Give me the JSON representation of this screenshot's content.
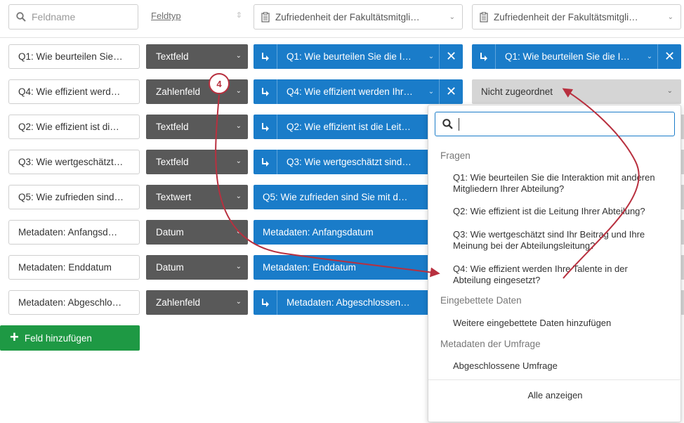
{
  "header": {
    "search_placeholder": "Feldname",
    "fieldtype_label": "Feldtyp",
    "survey_select_1": "Zufriedenheit der Fakultätsmitgli…",
    "survey_select_2": "Zufriedenheit der Fakultätsmitgli…"
  },
  "rows": [
    {
      "name": "Q1: Wie beurteilen Sie…",
      "type": "Textfeld",
      "map1": "Q1: Wie beurteilen Sie die I…",
      "map2": "Q1: Wie beurteilen Sie die I…"
    },
    {
      "name": "Q4: Wie effizient werd…",
      "type": "Zahlenfeld",
      "map1": "Q4: Wie effizient werden Ihr…",
      "map2": "Nicht zugeordnet"
    },
    {
      "name": "Q2: Wie effizient ist di…",
      "type": "Textfeld",
      "map1": "Q2: Wie effizient ist die Leit…"
    },
    {
      "name": "Q3: Wie wertgeschätzt…",
      "type": "Textfeld",
      "map1": "Q3: Wie wertgeschätzt sind…"
    },
    {
      "name": "Q5: Wie zufrieden sind…",
      "type": "Textwert",
      "map1": "Q5: Wie zufrieden sind Sie mit d…"
    },
    {
      "name": "Metadaten: Anfangsd…",
      "type": "Datum",
      "map1": "Metadaten: Anfangsdatum"
    },
    {
      "name": "Metadaten: Enddatum",
      "type": "Datum",
      "map1": "Metadaten: Enddatum"
    },
    {
      "name": "Metadaten: Abgeschlo…",
      "type": "Zahlenfeld",
      "map1": "Metadaten: Abgeschlossen…"
    }
  ],
  "add_field_label": "Feld hinzufügen",
  "badge_number": "4",
  "dropdown": {
    "section_questions": "Fragen",
    "questions": [
      "Q1: Wie beurteilen Sie die Interaktion mit anderen Mitgliedern Ihrer Abteilung?",
      "Q2: Wie effizient ist die Leitung Ihrer Abteilung?",
      "Q3: Wie wertgeschätzt sind Ihr Beitrag und Ihre Meinung bei der Abteilungsleitung?",
      "Q4: Wie effizient werden Ihre Talente in der Abteilung eingesetzt?"
    ],
    "section_embedded": "Eingebettete Daten",
    "embedded_more": "Weitere eingebettete Daten hinzufügen",
    "section_metadata": "Metadaten der Umfrage",
    "metadata_item": "Abgeschlossene Umfrage",
    "show_all": "Alle anzeigen"
  },
  "colors": {
    "blue": "#1a7cc9",
    "dark_gray": "#595959",
    "green": "#1e9944",
    "annotation_red": "#b8303f",
    "unmapped_gray": "#d5d5d5"
  }
}
